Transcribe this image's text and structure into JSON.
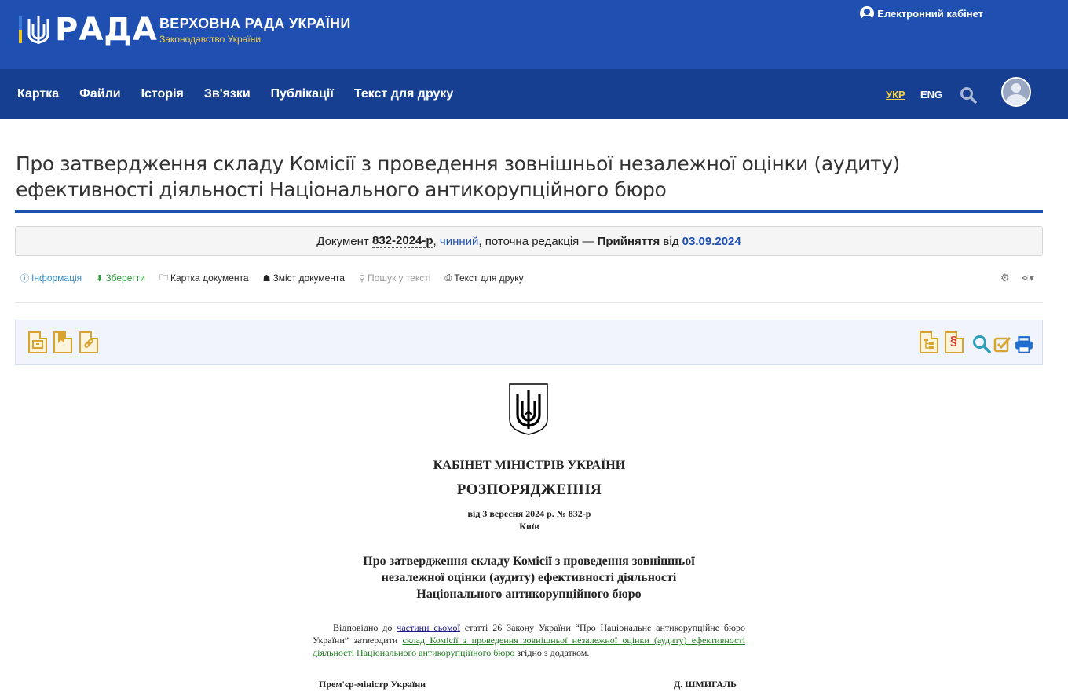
{
  "header": {
    "logo_text": "РАДА",
    "site_title": "ВЕРХОВНА РАДА УКРАЇНИ",
    "site_subtitle": "Законодавство України",
    "cabinet_label": "Електронний кабінет"
  },
  "nav": {
    "items": [
      "Картка",
      "Файли",
      "Історія",
      "Зв'язки",
      "Публікації",
      "Текст для друку"
    ],
    "lang_ukr": "УКР",
    "lang_eng": "ENG"
  },
  "doc": {
    "title": "Про затвердження складу Комісії з проведення зовнішньої незалежної оцінки (аудиту) ефективності діяльності Національного антикорупційного бюро",
    "status": {
      "prefix": "Документ ",
      "number": "832-2024-р",
      "comma1": ", ",
      "state": "чинний",
      "middle": ", поточна редакція — ",
      "adopted": "Прийняття",
      "from": " від ",
      "date": "03.09.2024"
    }
  },
  "actions": {
    "info": "Інформація",
    "save": "Зберегти",
    "card": "Картка документа",
    "contents": "Зміст документа",
    "search": "Пошук у тексті",
    "print": "Текст для друку"
  },
  "body": {
    "org": "КАБІНЕТ МІНІСТРІВ УКРАЇНИ",
    "kind": "РОЗПОРЯДЖЕННЯ",
    "date_line": "від 3 вересня 2024 р. № 832-р",
    "city": "Київ",
    "heading_1": "Про затвердження складу Комісії з проведення зовнішньої",
    "heading_2": "незалежної оцінки (аудиту) ефективності діяльності",
    "heading_3": "Національного антикорупційного бюро",
    "para_1": "Відповідно до ",
    "link_1": "частини сьомої",
    "para_2": " статті 26 Закону України “Про Національне антикорупційне бюро України” затвердити ",
    "link_2": "склад Комісії з проведення зовнішньої незалежної оцінки (аудиту) ефективності діяльності Національного антикорупційного бюро",
    "para_3": " згідно з додатком.",
    "sign_left": "Прем'єр-міністр України",
    "sign_right": "Д. ШМИГАЛЬ"
  },
  "colors": {
    "header_bg": "#1f4fb0",
    "nav_bg": "#163f91",
    "accent_yellow": "#f5d046",
    "link_blue": "#1f4fb0",
    "icon_gold": "#d8a331"
  }
}
